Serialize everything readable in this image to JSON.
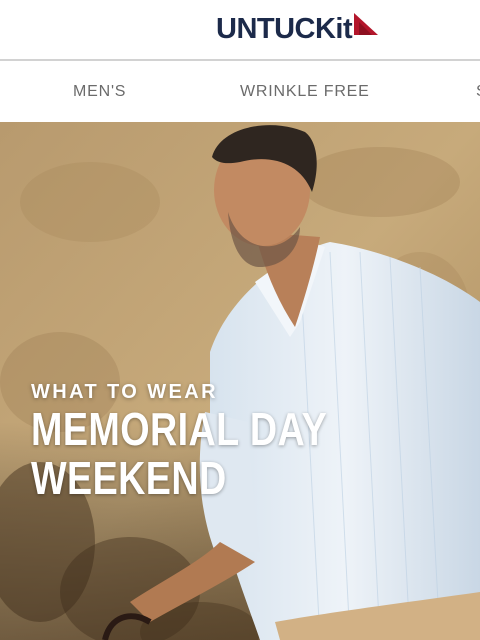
{
  "header": {
    "logo_text": "UNTUCKit",
    "logo_icon": "red-triangle-logo-mark",
    "brand_color": "#1c2a4a",
    "accent_color": "#b3162b"
  },
  "nav": {
    "items": [
      {
        "label": "MEN'S"
      },
      {
        "label": "WRINKLE FREE"
      },
      {
        "label": "S"
      }
    ]
  },
  "hero": {
    "kicker": "WHAT TO WEAR",
    "title_line1": "MEMORIAL DAY",
    "title_line2": "WEEKEND"
  }
}
